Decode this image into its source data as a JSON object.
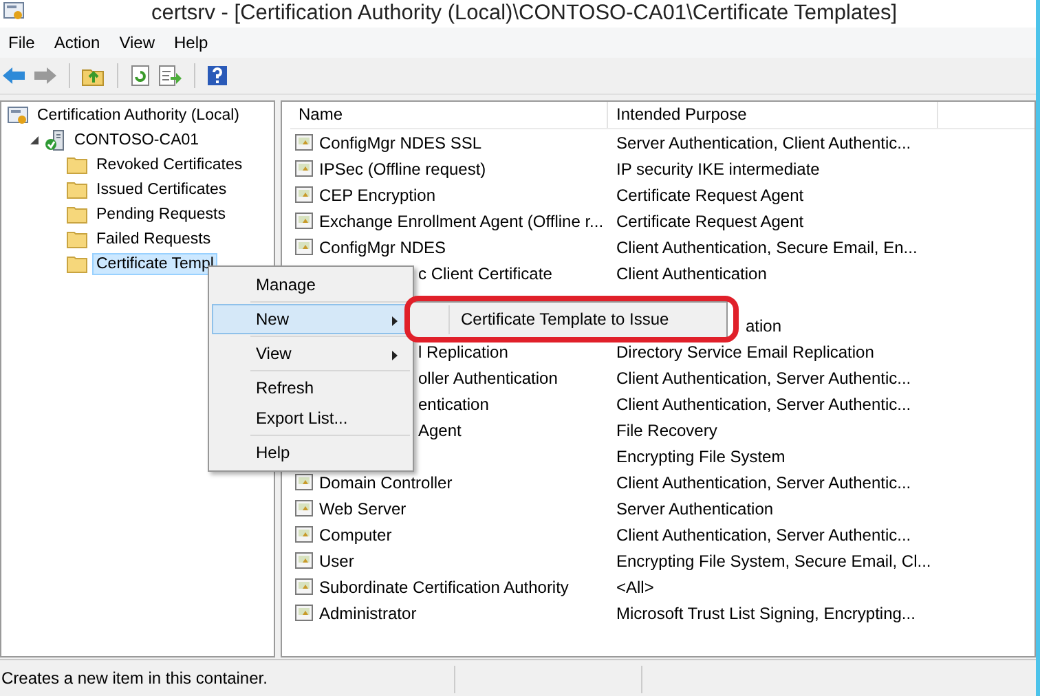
{
  "window": {
    "title": "certsrv - [Certification Authority (Local)\\CONTOSO-CA01\\Certificate Templates]"
  },
  "menu_bar": [
    "File",
    "Action",
    "View",
    "Help"
  ],
  "toolbar": [
    {
      "kind": "back",
      "disabled": false
    },
    {
      "kind": "forward",
      "disabled": true
    },
    {
      "kind": "sep"
    },
    {
      "kind": "up"
    },
    {
      "kind": "sep"
    },
    {
      "kind": "refresh"
    },
    {
      "kind": "export"
    },
    {
      "kind": "sep"
    },
    {
      "kind": "help"
    }
  ],
  "tree": [
    {
      "label": "Certification Authority (Local)",
      "kind": "root",
      "selected": false,
      "children": [
        {
          "label": "CONTOSO-CA01",
          "kind": "server",
          "selected": false,
          "expanded": true,
          "children": [
            {
              "label": "Revoked Certificates",
              "kind": "folder",
              "selected": false
            },
            {
              "label": "Issued Certificates",
              "kind": "folder",
              "selected": false
            },
            {
              "label": "Pending Requests",
              "kind": "folder",
              "selected": false
            },
            {
              "label": "Failed Requests",
              "kind": "folder",
              "selected": false
            },
            {
              "label": "Certificate Templ",
              "kind": "folder",
              "selected": true
            }
          ]
        }
      ]
    }
  ],
  "table": {
    "columns": [
      "Name",
      "Intended Purpose"
    ],
    "rows": [
      {
        "name": "ConfigMgr NDES SSL",
        "purpose": "Server Authentication, Client Authentic..."
      },
      {
        "name": "IPSec (Offline request)",
        "purpose": "IP security IKE intermediate"
      },
      {
        "name": "CEP Encryption",
        "purpose": "Certificate Request Agent"
      },
      {
        "name": "Exchange Enrollment Agent (Offline r...",
        "purpose": "Certificate Request Agent"
      },
      {
        "name": "ConfigMgr NDES",
        "purpose": "Client Authentication, Secure Email, En..."
      },
      {
        "name": "c Client Certificate",
        "covered": true,
        "purpose": "Client Authentication"
      },
      {},
      {
        "covered": true,
        "purpose": "ation",
        "purpose_covered": true
      },
      {
        "name": "l Replication",
        "covered": true,
        "purpose": "Directory Service Email Replication"
      },
      {
        "name": "oller Authentication",
        "covered": true,
        "purpose": "Client Authentication, Server Authentic..."
      },
      {
        "name": "entication",
        "covered": true,
        "purpose": "Client Authentication, Server Authentic..."
      },
      {
        "name": "Agent",
        "covered": true,
        "purpose": "File Recovery"
      },
      {
        "purpose": "Encrypting File System"
      },
      {
        "name": "Domain Controller",
        "purpose": "Client Authentication, Server Authentic..."
      },
      {
        "name": "Web Server",
        "purpose": "Server Authentication"
      },
      {
        "name": "Computer",
        "purpose": "Client Authentication, Server Authentic..."
      },
      {
        "name": "User",
        "purpose": "Encrypting File System, Secure Email, Cl..."
      },
      {
        "name": "Subordinate Certification Authority",
        "purpose": "<All>"
      },
      {
        "name": "Administrator",
        "purpose": "Microsoft Trust List Signing, Encrypting..."
      }
    ]
  },
  "context_menu": [
    {
      "kind": "item",
      "label": "Manage",
      "selected": false
    },
    {
      "kind": "separator"
    },
    {
      "kind": "item",
      "label": "New",
      "selected": true,
      "submenu": true
    },
    {
      "kind": "separator"
    },
    {
      "kind": "item",
      "label": "View",
      "selected": false,
      "submenu": true
    },
    {
      "kind": "separator"
    },
    {
      "kind": "item",
      "label": "Refresh",
      "selected": false
    },
    {
      "kind": "item",
      "label": "Export List...",
      "selected": false
    },
    {
      "kind": "separator"
    },
    {
      "kind": "item",
      "label": "Help",
      "selected": false
    }
  ],
  "submenu": [
    {
      "label": "Certificate Template to Issue",
      "highlighted": true
    }
  ],
  "status_bar": "Creates a new item in this container."
}
